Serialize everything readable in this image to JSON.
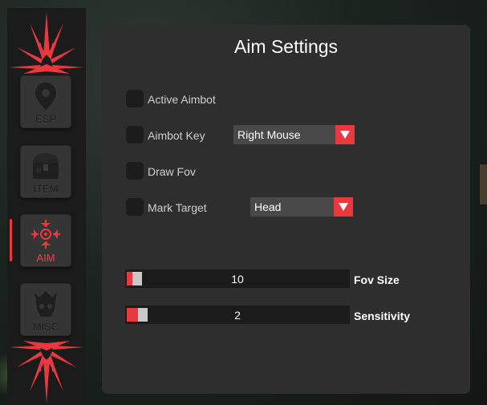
{
  "sidebar": {
    "items": [
      {
        "label": "ESP",
        "icon": "location-pin-icon",
        "active": false
      },
      {
        "label": "ITEM",
        "icon": "treasure-chest-icon",
        "active": false
      },
      {
        "label": "AIM",
        "icon": "crosshair-icon",
        "active": true
      },
      {
        "label": "MISC",
        "icon": "skull-icon",
        "active": false
      }
    ]
  },
  "panel": {
    "title": "Aim Settings",
    "options": [
      {
        "label": "Active Aimbot",
        "checked": false
      },
      {
        "label": "Aimbot Key",
        "checked": false,
        "dropdown": "Right Mouse"
      },
      {
        "label": "Draw Fov",
        "checked": false
      },
      {
        "label": "Mark Target",
        "checked": false,
        "dropdown": "Head"
      }
    ],
    "sliders": [
      {
        "label": "Fov Size",
        "value": "10"
      },
      {
        "label": "Sensitivity",
        "value": "2"
      }
    ]
  },
  "colors": {
    "accent": "#e8393e",
    "panel": "#2e2e2e",
    "sidebar": "#1b1b1b"
  }
}
